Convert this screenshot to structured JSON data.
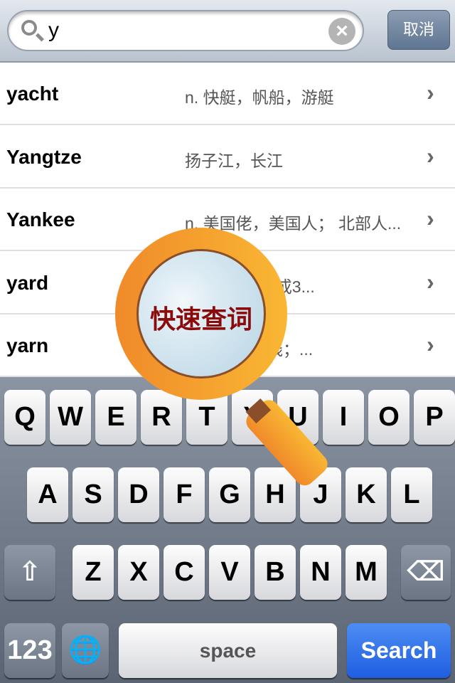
{
  "search": {
    "value": "y",
    "clear_icon": "clear-icon",
    "search_icon": "search-icon"
  },
  "cancel_label": "取消",
  "results": [
    {
      "word": "yacht",
      "definition": "n. 快艇，帆船，游艇"
    },
    {
      "word": "Yangtze",
      "definition": "扬子江，长江"
    },
    {
      "word": "Yankee",
      "definition": "n. 美国佬，美国人； 北部人..."
    },
    {
      "word": "yard",
      "definition": "（等于3英尺或3..."
    },
    {
      "word": "yarn",
      "definition": "（尤指）毛线；..."
    }
  ],
  "overlay": {
    "label": "快速查词",
    "label_color": "#8b0b0b"
  },
  "keyboard": {
    "row1": [
      "Q",
      "W",
      "E",
      "R",
      "T",
      "Y",
      "U",
      "I",
      "O",
      "P"
    ],
    "row2": [
      "A",
      "S",
      "D",
      "F",
      "G",
      "H",
      "J",
      "K",
      "L"
    ],
    "row3": [
      "Z",
      "X",
      "C",
      "V",
      "B",
      "N",
      "M"
    ],
    "shift": "⇧",
    "backspace": "⌫",
    "numbers": "123",
    "globe": "🌐",
    "space": "space",
    "search": "Search",
    "accent": "#1f5ee0"
  }
}
